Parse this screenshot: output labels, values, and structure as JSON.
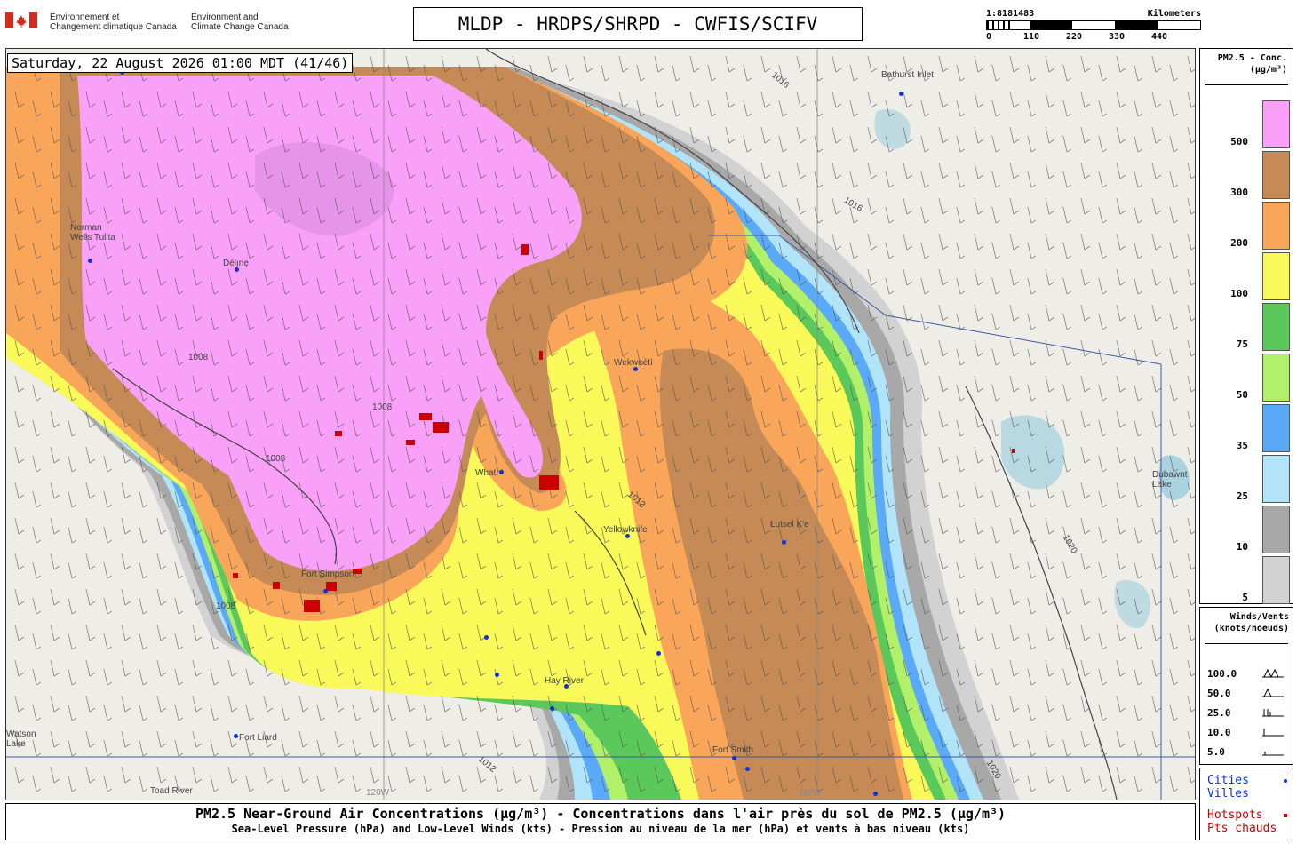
{
  "header": {
    "agency_fr": [
      "Environnement et",
      "Changement climatique Canada"
    ],
    "agency_en": [
      "Environment and",
      "Climate Change Canada"
    ],
    "title": "MLDP - HRDPS/SHRPD - CWFIS/SCIFV"
  },
  "scale": {
    "ratio": "1:8181483",
    "unit": "Kilometers",
    "ticks": [
      "0",
      "110",
      "220",
      "330",
      "440"
    ]
  },
  "map": {
    "timestamp": "Saturday, 22 August 2026 01:00 MDT (41/46)",
    "places": [
      "Bathurst Inlet",
      "Norman Wells Tulita",
      "Délı̨nę",
      "Whatì",
      "Wekweètì",
      "Yellowknife",
      "Łutsel K'e",
      "Fort Simpson",
      "Hay River",
      "Fort Smith",
      "Fort Liard",
      "Watson Lake",
      "Toad River",
      "120W",
      "110W",
      "Dubawnt Lake"
    ],
    "isobar_labels": [
      "1016",
      "1016",
      "1008",
      "1008",
      "1008",
      "1012",
      "1012",
      "1020",
      "1020",
      "1008"
    ]
  },
  "legend_pm": {
    "title_line1": "PM2.5 - Conc.",
    "title_line2": "(µg/m³)",
    "levels": [
      {
        "label": "500",
        "color": "#f9a0f9"
      },
      {
        "label": "300",
        "color": "#c58a55"
      },
      {
        "label": "200",
        "color": "#f9a65a"
      },
      {
        "label": "100",
        "color": "#f9f95a"
      },
      {
        "label": "75",
        "color": "#5ac85a"
      },
      {
        "label": "50",
        "color": "#b2f06a"
      },
      {
        "label": "35",
        "color": "#5aaaf9"
      },
      {
        "label": "25",
        "color": "#b2e4f9"
      },
      {
        "label": "10",
        "color": "#a8a8a8"
      },
      {
        "label": "5",
        "color": "#d2d2d2"
      }
    ]
  },
  "legend_wind": {
    "title_line1": "Winds/Vents",
    "title_line2": "(knots/noeuds)",
    "rows": [
      "100.0",
      "50.0",
      "25.0",
      "10.0",
      "5.0"
    ]
  },
  "legend_points": {
    "cities": "Cities",
    "villes": "Villes",
    "hotspots": "Hotspots",
    "pts_chauds": "Pts chauds",
    "city_color": "#1030e0",
    "hotspot_color": "#cc0000"
  },
  "footer": {
    "line1": "PM2.5 Near-Ground Air Concentrations (µg/m³) - Concentrations dans l'air près du sol de PM2.5 (µg/m³)",
    "line2": "Sea-Level Pressure (hPa) and Low-Level Winds (kts) - Pression au niveau de la mer (hPa) et vents à bas niveau (kts)"
  }
}
